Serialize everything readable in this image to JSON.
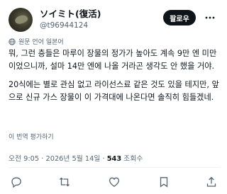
{
  "author": {
    "display_name": "ソイミト(復活)",
    "handle": "@t96944124"
  },
  "follow_label": "팔로우",
  "translation_note": "원문 언어 일본어",
  "body": {
    "paragraph1": "뭐, 그런 층들은 마루이 장물의 정가가 높아도 계속 9만 엔 미만이었으니까, 설마 14만 엔에 나올 거라곤 생각도 안 했을 거야.",
    "paragraph2": "20식에는 별로 관심 없고 라이선스료 같은 것도 있을 테지만, 앞으로 신규 가스 장물이 이 가격대에 나온다면 솔직히 힘들겠네."
  },
  "rate_translation": "이 번역 평가하기",
  "meta": {
    "timestamp": "오전 9:05 · 2026년 5월 14일 · ",
    "views_count": "543",
    "views_label": " 조회수"
  },
  "icons": [
    "more-icon",
    "globe-icon",
    "reply-icon",
    "retweet-icon",
    "like-icon",
    "bookmark-icon",
    "share-icon"
  ]
}
